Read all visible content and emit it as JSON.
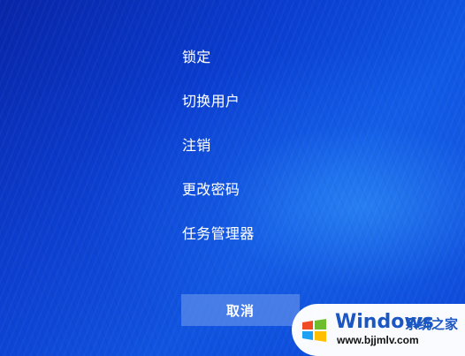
{
  "menu": {
    "items": [
      {
        "label": "锁定"
      },
      {
        "label": "切换用户"
      },
      {
        "label": "注销"
      },
      {
        "label": "更改密码"
      },
      {
        "label": "任务管理器"
      }
    ]
  },
  "actions": {
    "cancel_label": "取消"
  },
  "watermark": {
    "brand": "Windows",
    "suffix": "系统之家",
    "domain": "www.bjjmlv.com",
    "colors": {
      "text": "#1b57c2",
      "background": "#ffffff"
    }
  },
  "theme": {
    "background_primary": "#0a3ccf",
    "background_accent": "#0f58e4",
    "button_background": "#5d8ce9",
    "text": "#ffffff"
  },
  "icons": {
    "watermark_logo": "windows-logo-icon"
  }
}
